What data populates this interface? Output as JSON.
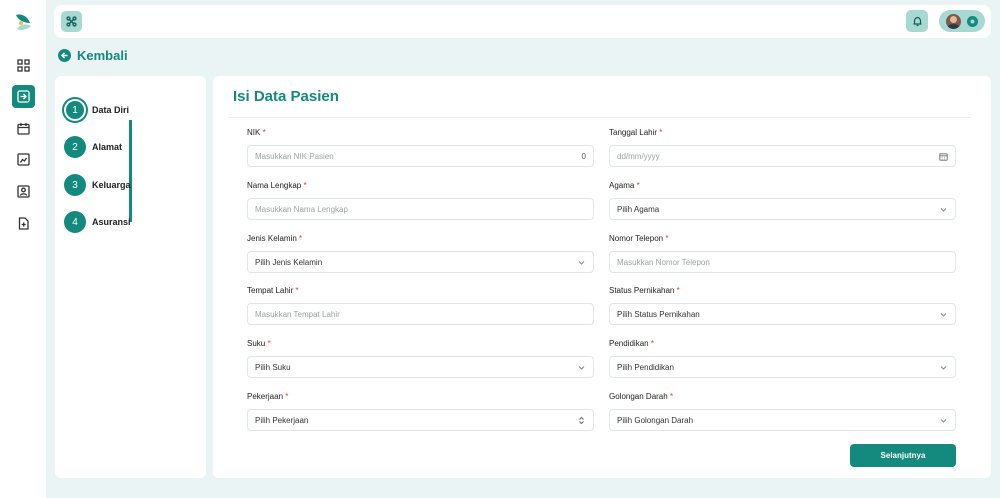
{
  "header": {
    "back_label": "Kembali"
  },
  "stepper": {
    "steps": [
      {
        "number": "1",
        "label": "Data Diri"
      },
      {
        "number": "2",
        "label": "Alamat"
      },
      {
        "number": "3",
        "label": "Keluarga"
      },
      {
        "number": "4",
        "label": "Asuransi"
      }
    ]
  },
  "form": {
    "title": "Isi Data Pasien",
    "required_mark": "*",
    "fields": {
      "nik": {
        "label": "NIK",
        "placeholder": "Masukkan NIK Pasien",
        "suffix": "0"
      },
      "tanggal_lahir": {
        "label": "Tanggal Lahir",
        "placeholder": "dd/mm/yyyy"
      },
      "nama_lengkap": {
        "label": "Nama Lengkap",
        "placeholder": "Masukkan Nama Lengkap"
      },
      "agama": {
        "label": "Agama",
        "value": "Pilih Agama"
      },
      "jenis_kelamin": {
        "label": "Jenis Kelamin",
        "value": "Pilih Jenis Kelamin"
      },
      "nomor_telepon": {
        "label": "Nomor Telepon",
        "placeholder": "Masukkan Nomor Telepon"
      },
      "tempat_lahir": {
        "label": "Tempat Lahir",
        "placeholder": "Masukkan Tempat Lahir"
      },
      "status_pernikahan": {
        "label": "Status Pernikahan",
        "value": "Pilih Status Pernikahan"
      },
      "suku": {
        "label": "Suku",
        "value": "Pilih Suku"
      },
      "pendidikan": {
        "label": "Pendidikan",
        "value": "Pilih Pendidikan"
      },
      "pekerjaan": {
        "label": "Pekerjaan",
        "value": "Pilih Pekerjaan"
      },
      "golongan_darah": {
        "label": "Golongan Darah",
        "value": "Pilih Golongan Darah"
      }
    },
    "next_label": "Selanjutnya"
  },
  "colors": {
    "accent": "#138a7d",
    "accent_light": "#a8d8d2",
    "required": "#e0392b",
    "background": "#eaf4f4"
  },
  "icons": [
    "app-logo",
    "dashboard-icon",
    "register-icon",
    "calendar-icon",
    "report-icon",
    "patient-card-icon",
    "document-add-icon",
    "menu-icon",
    "bell-icon",
    "gear-icon",
    "back-arrow-icon",
    "calendar-picker-icon",
    "chevron-down-icon",
    "updown-icon"
  ]
}
